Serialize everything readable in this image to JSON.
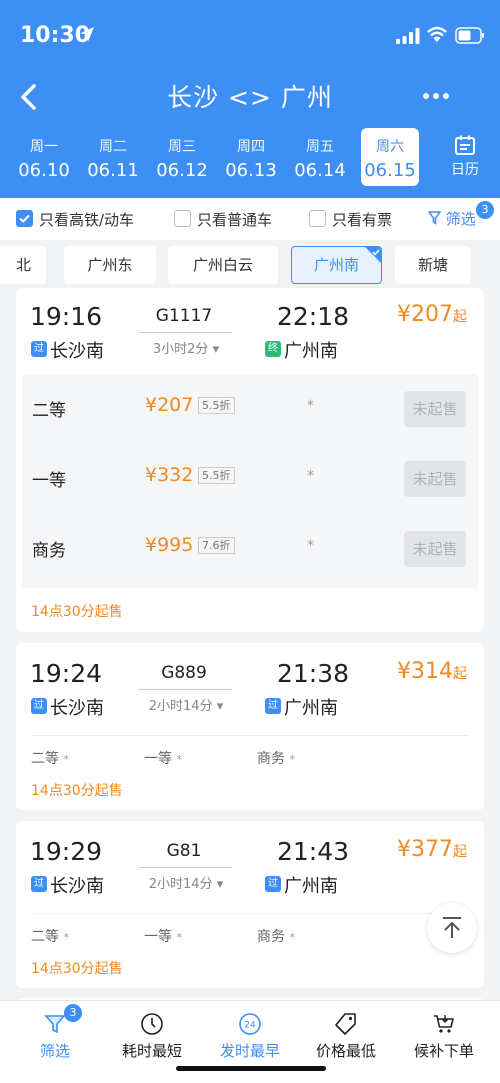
{
  "status_bar": {
    "time": "10:30"
  },
  "nav": {
    "title": "长沙 <> 广州"
  },
  "dates": [
    {
      "weekday": "周一",
      "date": "06.10"
    },
    {
      "weekday": "周二",
      "date": "06.11"
    },
    {
      "weekday": "周三",
      "date": "06.12"
    },
    {
      "weekday": "周四",
      "date": "06.13"
    },
    {
      "weekday": "周五",
      "date": "06.14"
    },
    {
      "weekday": "周六",
      "date": "06.15",
      "selected": true
    }
  ],
  "calendar_label": "日历",
  "filters": {
    "high_speed": "只看高铁/动车",
    "normal": "只看普通车",
    "has_ticket": "只看有票",
    "filter_label": "筛选",
    "filter_count": "3"
  },
  "stations": [
    "北",
    "广州东",
    "广州白云",
    "广州南",
    "新塘"
  ],
  "selected_station": "广州南",
  "trains": [
    {
      "dep_time": "19:16",
      "train_no": "G1117",
      "arr_time": "22:18",
      "duration": "3小时2分",
      "price": "¥207",
      "price_suffix": "起",
      "dep_tag": "过",
      "dep_station": "长沙南",
      "arr_tag": "终",
      "arr_station": "广州南",
      "seats": [
        {
          "name": "二等",
          "price": "¥207",
          "discount": "5.5折",
          "count": "*",
          "button": "未起售"
        },
        {
          "name": "一等",
          "price": "¥332",
          "discount": "5.5折",
          "count": "*",
          "button": "未起售"
        },
        {
          "name": "商务",
          "price": "¥995",
          "discount": "7.6折",
          "count": "*",
          "button": "未起售"
        }
      ],
      "sale_time": "14点30分起售"
    },
    {
      "dep_time": "19:24",
      "train_no": "G889",
      "arr_time": "21:38",
      "duration": "2小时14分",
      "price": "¥314",
      "price_suffix": "起",
      "dep_tag": "过",
      "dep_station": "长沙南",
      "arr_tag": "过",
      "arr_station": "广州南",
      "seats": [
        {
          "name": "二等",
          "count": "*"
        },
        {
          "name": "一等",
          "count": "*"
        },
        {
          "name": "商务",
          "count": "*"
        }
      ],
      "sale_time": "14点30分起售"
    },
    {
      "dep_time": "19:29",
      "train_no": "G81",
      "arr_time": "21:43",
      "duration": "2小时14分",
      "price": "¥377",
      "price_suffix": "起",
      "dep_tag": "过",
      "dep_station": "长沙南",
      "arr_tag": "过",
      "arr_station": "广州南",
      "seats": [
        {
          "name": "二等",
          "count": "*"
        },
        {
          "name": "一等",
          "count": "*"
        },
        {
          "name": "商务",
          "count": "*"
        }
      ],
      "sale_time": "14点30分起售"
    }
  ],
  "bottom_bar": {
    "filter": "筛选",
    "filter_badge": "3",
    "shortest": "耗时最短",
    "earliest": "发时最早",
    "earliest_icon_text": "24",
    "cheapest": "价格最低",
    "waitlist": "候补下单"
  },
  "colors": {
    "primary": "#3d8ff3",
    "price": "#f08a24",
    "green_tag": "#2dbb7a"
  },
  "icons": [
    "location-arrow-icon",
    "signal-icon",
    "wifi-icon",
    "battery-icon",
    "back-icon",
    "more-icon",
    "calendar-icon",
    "funnel-icon",
    "timer-icon",
    "clock-24-icon",
    "price-tag-icon",
    "cart-icon",
    "scroll-top-icon"
  ]
}
